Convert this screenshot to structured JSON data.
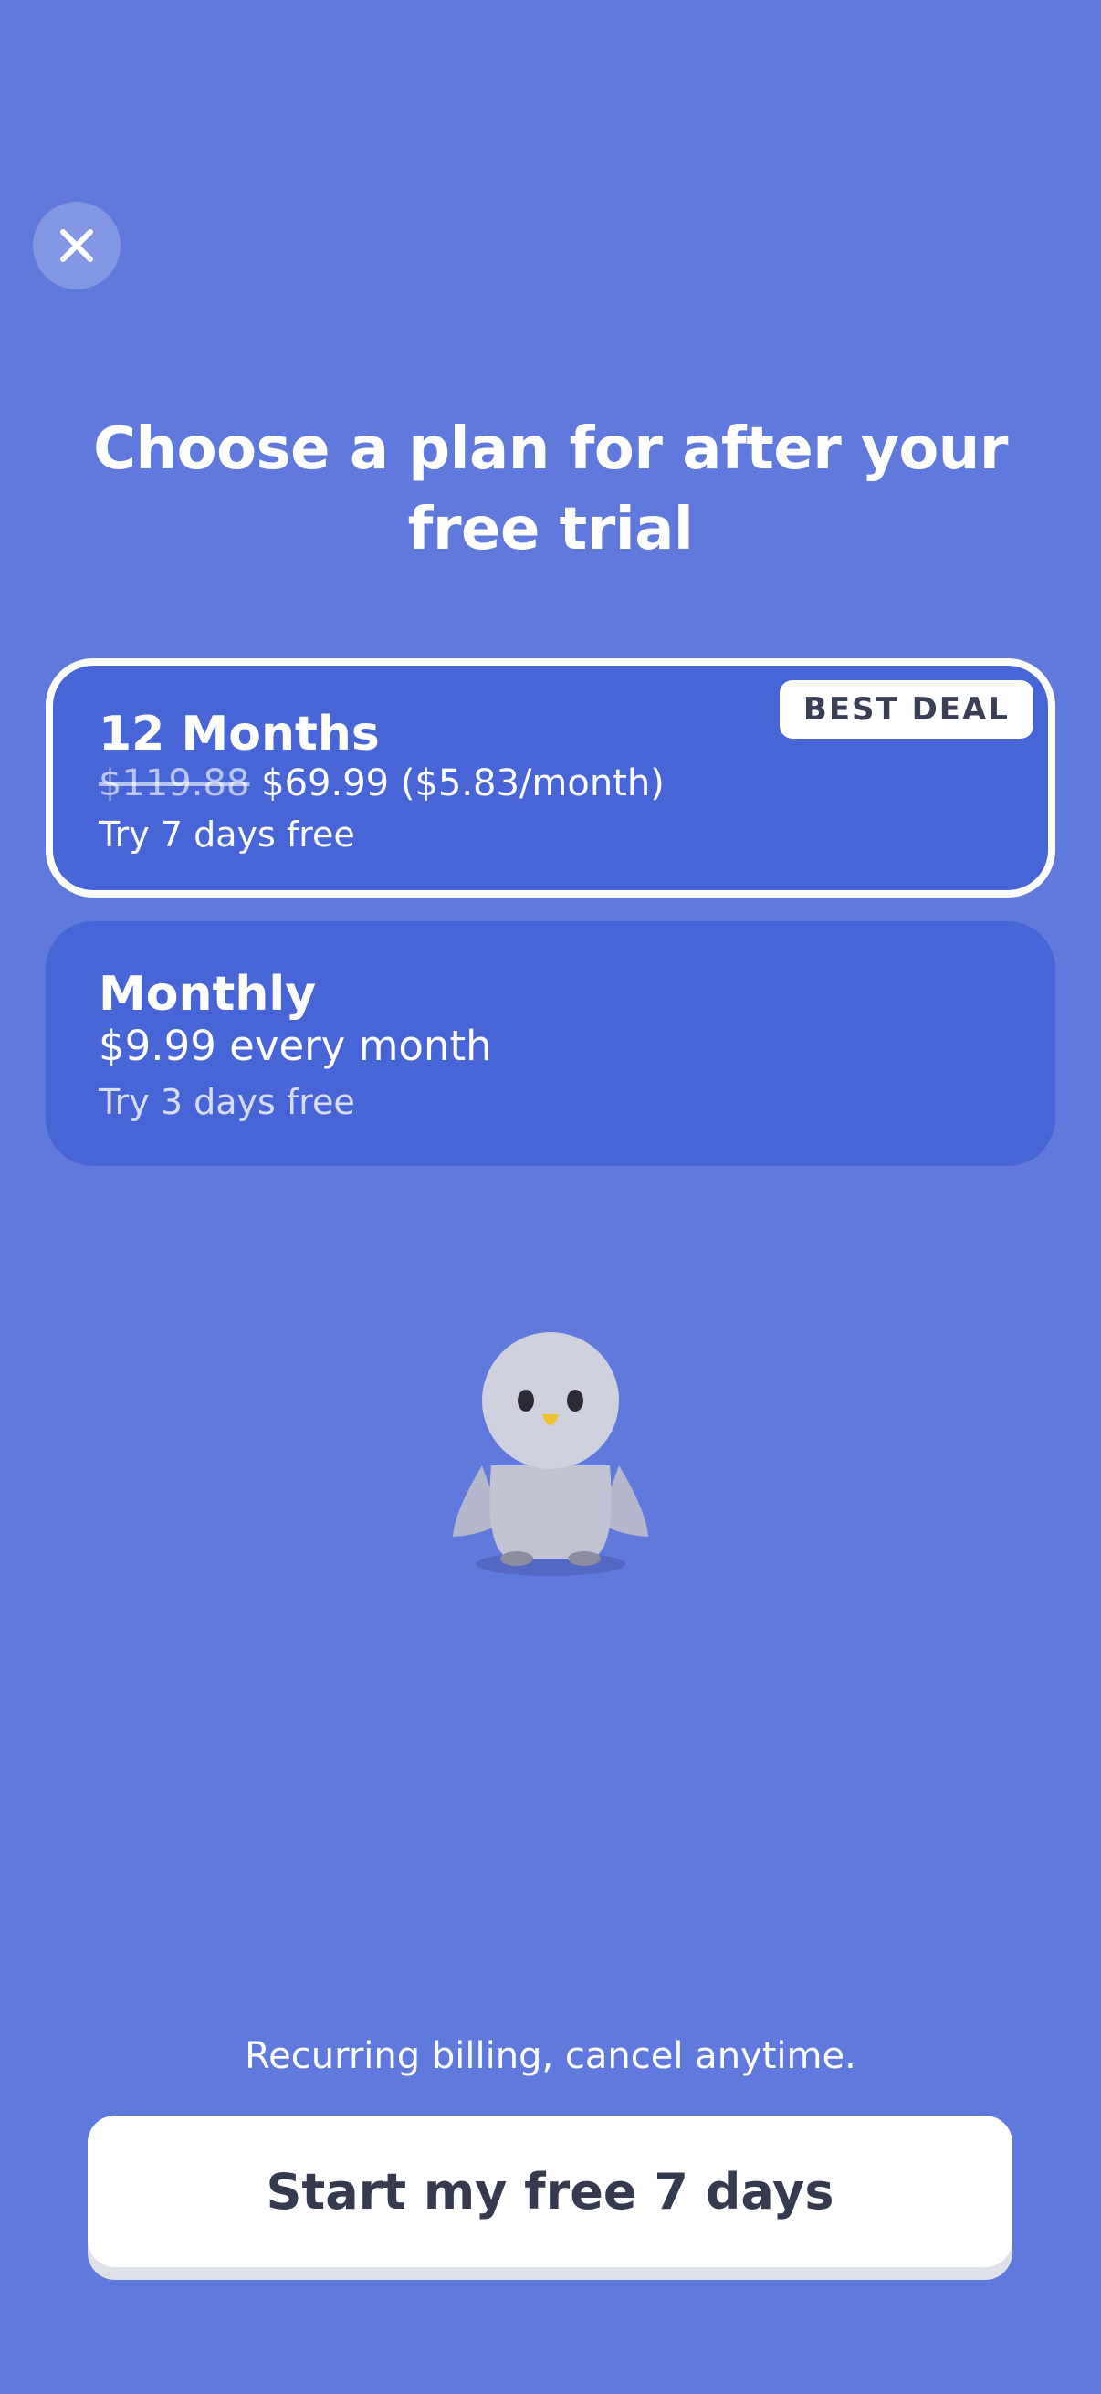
{
  "header": {
    "close_icon": "close-icon",
    "title": "Choose a plan for after your free trial"
  },
  "plans": [
    {
      "name": "12 Months",
      "old_price": "$119.88",
      "price": "$69.99 ($5.83/month)",
      "trial": "Try 7 days free",
      "badge": "BEST DEAL",
      "selected": true
    },
    {
      "name": "Monthly",
      "price": "$9.99 every month",
      "trial": "Try 3 days free",
      "selected": false
    }
  ],
  "mascot": {
    "icon": "penguin-mascot-icon"
  },
  "footer": {
    "billing_note": "Recurring billing, cancel anytime.",
    "cta_label": "Start my free 7 days"
  },
  "colors": {
    "background": "#6079dc",
    "plan_card": "#4865d8",
    "selected_border": "#ffffff",
    "cta_text": "#363a4f",
    "badge_text": "#3b3f55"
  }
}
